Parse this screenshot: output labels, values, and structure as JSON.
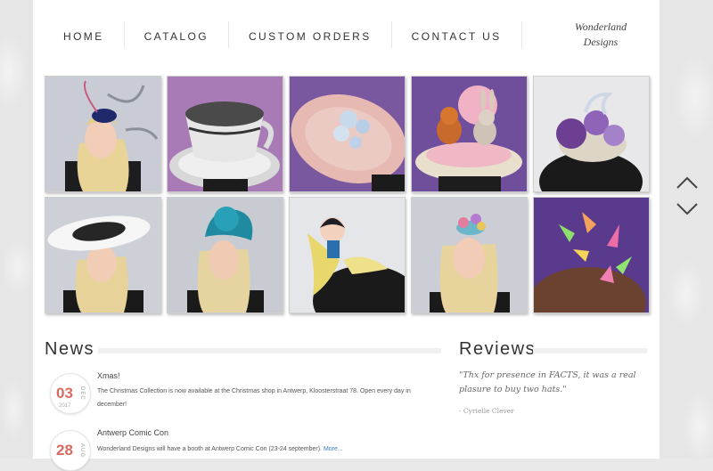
{
  "nav": {
    "items": [
      "HOME",
      "CATALOG",
      "CUSTOM ORDERS",
      "CONTACT US"
    ]
  },
  "logo": {
    "line1": "Wonderland",
    "line2": "Designs"
  },
  "gallery": {
    "images": [
      "navy-fascinator-woman",
      "silver-teacup-hat",
      "pink-crochet-hat",
      "squirrel-bunny-hat",
      "purple-flower-fascinator",
      "white-black-brim-hat",
      "teal-turban-woman",
      "doll-headpiece",
      "floral-fascinator-woman",
      "butterfly-headpiece"
    ]
  },
  "news": {
    "title": "News",
    "items": [
      {
        "title": "Xmas!",
        "text": "The Christmas Collection is now available at the Christmas shop in Antwerp, Kloosterstraat 78. Open every day in december!",
        "day": "03",
        "month": "DEC",
        "year": "2017"
      },
      {
        "title": "Antwerp Comic Con",
        "text": "Wonderland Designs will have a booth at Antwerp Comic Con (23-24 september).",
        "more": "More...",
        "day": "28",
        "month": "AUG"
      }
    ]
  },
  "reviews": {
    "title": "Reviews",
    "quote": "\"Thx for presence in FACTS, it was a real plasure to buy two hats.\"",
    "author": "- Cyrielle Clever"
  },
  "colors": {
    "accent": "#d76b5f",
    "link": "#3a7fbf"
  }
}
